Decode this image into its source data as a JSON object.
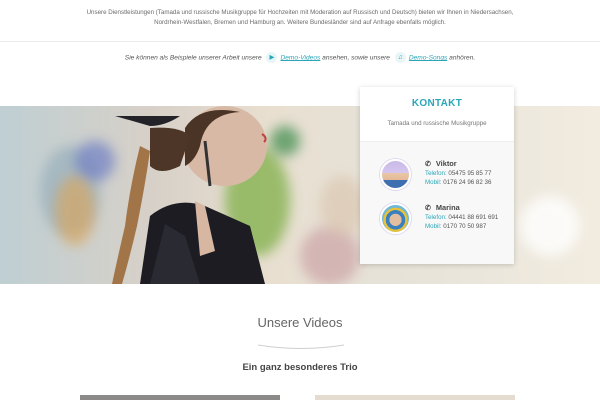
{
  "intro": {
    "line1": "Unsere Dienstleistungen (Tamada und russische Musikgruppe für Hochzeiten mit Moderation auf Russisch und Deutsch) bieten wir Ihnen in Niedersachsen,",
    "line2": "Nordrhein-Westfalen, Bremen und Hamburg an. Weitere Bundesländer sind auf Anfrage ebenfalls möglich."
  },
  "demo": {
    "text1": "Sie können als Beispiele unserer Arbeit unsere",
    "link_videos": "Demo-Videos",
    "text2": "ansehen, sowie unsere",
    "link_songs": "Demo-Songs",
    "text3": "anhören."
  },
  "contact": {
    "title": "KONTAKT",
    "subtitle": "Tamada und russische Musikgruppe",
    "persons": [
      {
        "name": "Viktor",
        "phone_label": "Telefon:",
        "phone": "05475 95 85 77",
        "mobile_label": "Mobil:",
        "mobile": "0176 24 96 82 36"
      },
      {
        "name": "Marina",
        "phone_label": "Telefon:",
        "phone": "04441 88 691 691",
        "mobile_label": "Mobil:",
        "mobile": "0170 70 50 987"
      }
    ]
  },
  "videos": {
    "section_title": "Unsere Videos",
    "subtitle": "Ein ganz besonderes Trio"
  },
  "colors": {
    "accent": "#2aa6b8",
    "text": "#555555"
  },
  "icons": {
    "video": "video-camera-icon",
    "music": "music-note-icon",
    "phone": "phone-icon"
  }
}
